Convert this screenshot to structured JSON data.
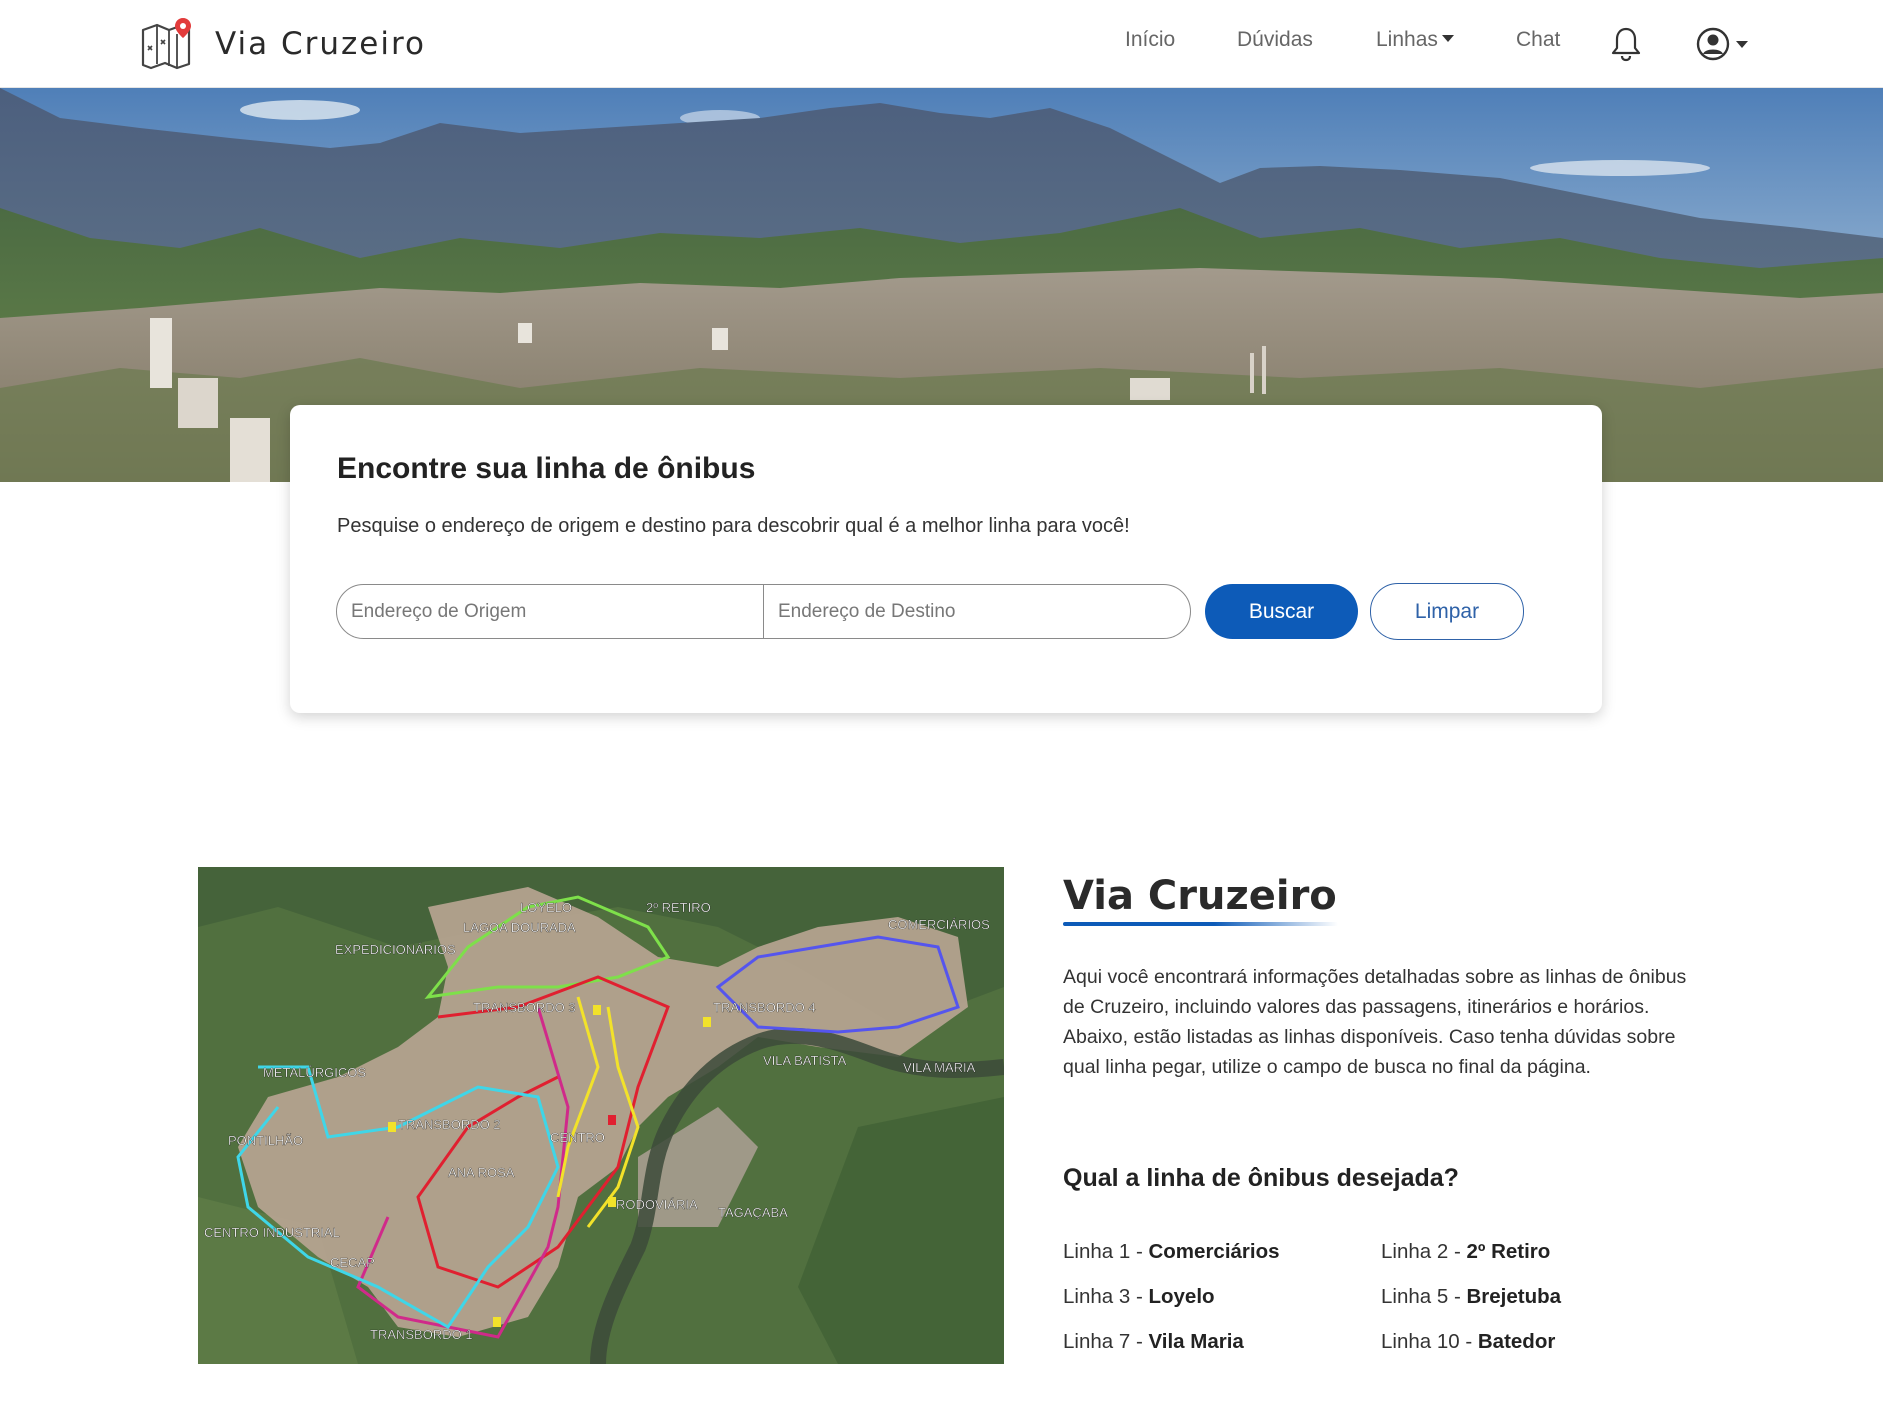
{
  "brand": {
    "name": "Via Cruzeiro"
  },
  "nav": {
    "links": [
      "Início",
      "Dúvidas",
      "Linhas",
      "Chat"
    ]
  },
  "search": {
    "title": "Encontre sua linha de ônibus",
    "subtitle": "Pesquise o endereço de origem e destino para descobrir qual é a melhor linha para você!",
    "origin_placeholder": "Endereço de Origem",
    "destination_placeholder": "Endereço de Destino",
    "search_label": "Buscar",
    "clear_label": "Limpar"
  },
  "map": {
    "labels": [
      "LOYELO",
      "2º RETIRO",
      "COMERCIÁRIOS",
      "LAGOA DOURADA",
      "EXPEDICIONÁRIOS",
      "TRANSBORDO 3",
      "TRANSBORDO 4",
      "VILA BATISTA",
      "VILA MARIA",
      "METALÚRGICOS",
      "PONTILHÃO",
      "TRANSBORDO 2",
      "CENTRO",
      "ANA ROSA",
      "RODOVIÁRIA",
      "TAGAÇABA",
      "CENTRO INDUSTRIAL",
      "CECAP",
      "TRANSBORDO 1"
    ]
  },
  "about": {
    "title": "Via Cruzeiro",
    "text": "Aqui você encontrará informações detalhadas sobre as linhas de ônibus de Cruzeiro, incluindo valores das passagens, itinerários e horários. Abaixo, estão listadas as linhas disponíveis. Caso tenha dúvidas sobre qual linha pegar, utilize o campo de busca no final da página.",
    "lines_title": "Qual a linha de ônibus desejada?",
    "lines": [
      {
        "prefix": "Linha 1 - ",
        "name": "Comerciários"
      },
      {
        "prefix": "Linha 2 - ",
        "name": "2º Retiro"
      },
      {
        "prefix": "Linha 3 - ",
        "name": "Loyelo"
      },
      {
        "prefix": "Linha 5 - ",
        "name": "Brejetuba"
      },
      {
        "prefix": "Linha 7 - ",
        "name": "Vila Maria"
      },
      {
        "prefix": "Linha 10 - ",
        "name": "Batedor"
      }
    ]
  },
  "colors": {
    "primary": "#0d5bb8",
    "route_green": "#7ee04a",
    "route_blue": "#5555ee",
    "route_red": "#e02030",
    "route_magenta": "#d02a8a",
    "route_cyan": "#3fd6e8",
    "route_yellow": "#f2e22a"
  }
}
